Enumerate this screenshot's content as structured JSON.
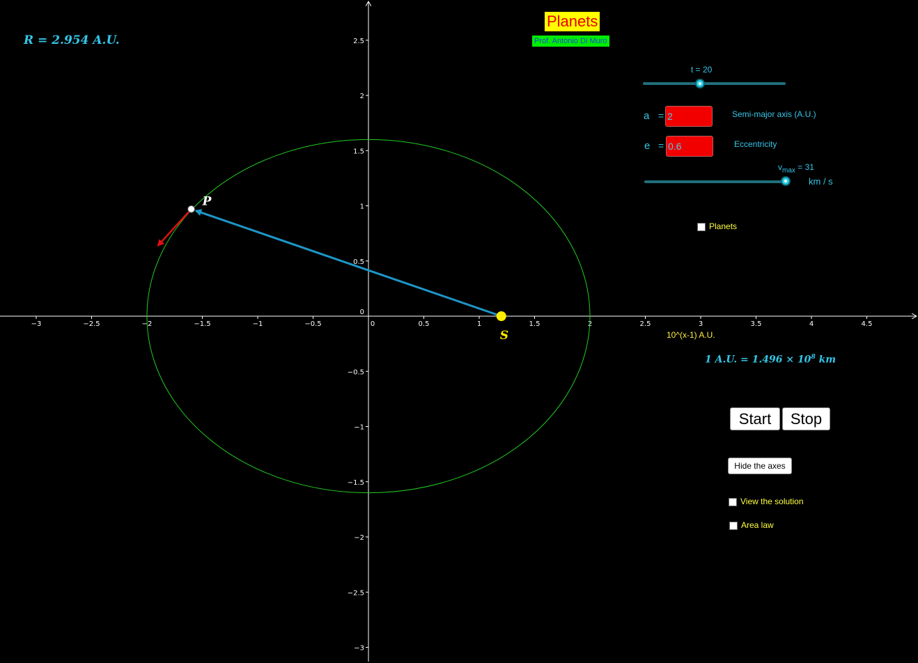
{
  "title": "Planets",
  "author": "Prof. Antonio Di Muro",
  "radius_label": "R = 2.954 A.U.",
  "au_conversion": {
    "prefix": "1 A.U. = 1.496 × 10",
    "exp": "8",
    "suffix": " km"
  },
  "axis": {
    "x_unit_label": "10^(x-1)  A.U.",
    "x_ticks": [
      "−3",
      "−2.5",
      "−2",
      "−1.5",
      "−1",
      "−0.5",
      "0",
      "0.5",
      "1",
      "1.5",
      "2",
      "2.5",
      "3",
      "3.5",
      "4",
      "4.5"
    ],
    "y_ticks": [
      "2.5",
      "2",
      "1.5",
      "1",
      "0.5",
      "0",
      "−0.5",
      "−1",
      "−1.5",
      "−2",
      "−2.5",
      "−3"
    ],
    "x_ticks_values": [
      -3,
      -2.5,
      -2,
      -1.5,
      -1,
      -0.5,
      0,
      0.5,
      1,
      1.5,
      2,
      2.5,
      3,
      3.5,
      4,
      4.5
    ],
    "y_ticks_values": [
      2.5,
      2,
      1.5,
      1,
      0.5,
      0,
      -0.5,
      -1,
      -1.5,
      -2,
      -2.5,
      -3
    ]
  },
  "orbit": {
    "center_x": 0,
    "center_y": 0,
    "semi_major": 2,
    "semi_minor": 1.6,
    "color": "#22cc22"
  },
  "sun": {
    "label": "S",
    "x": 1.2,
    "y": 0,
    "color": "#ffee00"
  },
  "planet": {
    "label": "P",
    "x": -1.6,
    "y": 0.97,
    "color": "#ffffff"
  },
  "radius_vector_color": "#1e96c8",
  "velocity_vector": {
    "color": "#e01010",
    "dx": -0.3,
    "dy": -0.33
  },
  "controls": {
    "t_slider": {
      "label": "t = 20",
      "value": 20,
      "min": 0,
      "max": 50
    },
    "a_input": {
      "label": "a",
      "value": "2",
      "description": "Semi-major axis (A.U.)"
    },
    "e_input": {
      "label": "e",
      "value": "0.6",
      "description": "Eccentricity"
    },
    "vmax_slider": {
      "label_main": "v",
      "label_sub": "max",
      "label_value": " = 31",
      "unit": "km / s",
      "value": 31,
      "min": 0,
      "max": 31
    },
    "planets_checkbox": "Planets",
    "start_button": "Start",
    "stop_button": "Stop",
    "hide_axes_button": "Hide the axes",
    "view_solution_checkbox": "View the solution",
    "area_law_checkbox": "Area law"
  }
}
